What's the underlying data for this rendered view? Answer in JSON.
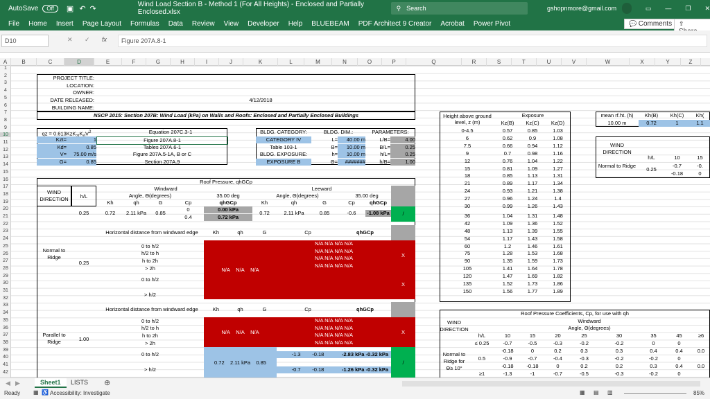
{
  "titlebar": {
    "autosave": "AutoSave",
    "toggle": "Off",
    "filename": "Wind Load Section B - Method 1 (For All Heights) - Enclosed and Partially Enclosed.xlsx",
    "search": "Search",
    "user": "gshopnmore@gmail.com"
  },
  "ribbon": {
    "tabs": [
      "File",
      "Home",
      "Insert",
      "Page Layout",
      "Formulas",
      "Data",
      "Review",
      "View",
      "Developer",
      "Help",
      "BLUEBEAM",
      "PDF Architect 9 Creator",
      "Acrobat",
      "Power Pivot"
    ],
    "comments": "Comments",
    "share": "Share"
  },
  "formula": {
    "namebox": "D10",
    "fx": "fx",
    "content": "Figure 207A.8-1"
  },
  "columns": [
    "A",
    "B",
    "C",
    "D",
    "E",
    "F",
    "G",
    "H",
    "I",
    "J",
    "K",
    "L",
    "M",
    "N",
    "O",
    "P",
    "Q",
    "R",
    "S",
    "T",
    "U",
    "V",
    "W",
    "X",
    "Y",
    "Z"
  ],
  "project": {
    "labels": [
      "PROJECT TITLE:",
      "LOCATION:",
      "OWNER:",
      "DATE RELEASED:",
      "BUILDING NAME:"
    ],
    "date": "4/12/2018",
    "heading": "NSCP 2015: Section 207B: Wind Load (kPa) on Walls and Roofs: Enclosed and Partially Enclosed Buildings"
  },
  "qz": {
    "formula": "qz = 0.613K",
    "eqn": "Equation 207C.3-1",
    "rows": [
      {
        "k": "Kzt=",
        "v": "1",
        "ref": "Figure 207A.8-1"
      },
      {
        "k": "Kd=",
        "v": "0.85",
        "ref": "Tables 207A.6-1"
      },
      {
        "k": "V=",
        "v": "75.00 m/s",
        "ref": "Figure 207A.5-1A, B or C"
      },
      {
        "k": "G=",
        "v": "0.85",
        "ref": "Section 207A.9"
      }
    ]
  },
  "bldg": {
    "cat_label": "BLDG. CATEGORY:",
    "cat": "CATEGORY IV",
    "cat_ref": "Table 103-1",
    "exp_label": "BLDG. EXPOSURE:",
    "exp": "EXPOSURE B",
    "dim_label": "BLDG. DIM.:",
    "dims": [
      {
        "k": "L=",
        "v": "40.00 m"
      },
      {
        "k": "B=",
        "v": "10.00 m"
      },
      {
        "k": "h=",
        "v": "10.00 m"
      },
      {
        "k": "Θ=",
        "v": "#######"
      }
    ],
    "param_label": "PARAMETERS:",
    "params": [
      {
        "k": "L/B=",
        "v": "4.00"
      },
      {
        "k": "B/L=",
        "v": "0.25"
      },
      {
        "k": "h/L=",
        "v": "0.25"
      },
      {
        "k": "h/B=",
        "v": "1.00"
      }
    ]
  },
  "roof": {
    "title": "Roof Pressure, q",
    "wind_dir": "WIND DIRECTION",
    "hl": "h/L",
    "windward": "Windward",
    "leeward": "Leeward",
    "angle": "Angle, Θ(degrees)",
    "deg": "35.00 deg",
    "sub": [
      "Kh",
      "qh",
      "G",
      "Cp",
      "qhGCp",
      "Kh",
      "qh",
      "G",
      "Cp",
      "qhGCp"
    ],
    "row1": {
      "hl": "0.25",
      "kh": "0.72",
      "qh": "2.11 kPa",
      "g": "0.85",
      "cp1": "0",
      "cp2": "0.4",
      "q1": "0.00 kPa",
      "q2": "0.72 kPa",
      "lkh": "0.72",
      "lqh": "2.11 kPa",
      "lg": "0.85",
      "lcp": "-0.6",
      "lq": "-1.08 kPa",
      "mark": "/"
    },
    "horiz": "Horizontal distance from windward edge",
    "normal": "Normal to Ridge",
    "parallel": "Parallel to Ridge",
    "dist1": [
      "0 to h/2",
      "h/2 to h",
      "h to 2h",
      "> 2h",
      "0 to h/2",
      "> h/2"
    ],
    "na": "N/A",
    "x": "X",
    "hl2": "0.25",
    "hl3": "1.00",
    "last": [
      {
        "d": "0 to h/2",
        "cp": "-1.3",
        "cp2": "-0.18",
        "q1": "-2.83 kPa",
        "q2": "-0.32 kPa"
      },
      {
        "d": "> h/2",
        "cp": "-0.7",
        "cp2": "-0.18",
        "q1": "-1.26 kPa",
        "q2": "-0.32 kPa"
      }
    ],
    "last_kh": "0.72",
    "last_qh": "2.11 kPa",
    "last_g": "0.85"
  },
  "exposure": {
    "h_label": "Height above ground level, z (m)",
    "title": "Exposure",
    "cols": [
      "Kz(B)",
      "Kz(C)",
      "Kz(D)"
    ],
    "rows": [
      [
        "0-4.5",
        "0.57",
        "0.85",
        "1.03"
      ],
      [
        "6",
        "0.62",
        "0.9",
        "1.08"
      ],
      [
        "7.5",
        "0.66",
        "0.94",
        "1.12"
      ],
      [
        "9",
        "0.7",
        "0.98",
        "1.16"
      ],
      [
        "12",
        "0.76",
        "1.04",
        "1.22"
      ],
      [
        "15",
        "0.81",
        "1.09",
        "1.27"
      ],
      [
        "18",
        "0.85",
        "1.13",
        "1.31"
      ],
      [
        "21",
        "0.89",
        "1.17",
        "1.34"
      ],
      [
        "24",
        "0.93",
        "1.21",
        "1.38"
      ],
      [
        "27",
        "0.96",
        "1.24",
        "1.4"
      ],
      [
        "30",
        "0.99",
        "1.26",
        "1.43"
      ],
      [
        "36",
        "1.04",
        "1.31",
        "1.48"
      ],
      [
        "42",
        "1.09",
        "1.36",
        "1.52"
      ],
      [
        "48",
        "1.13",
        "1.39",
        "1.55"
      ],
      [
        "54",
        "1.17",
        "1.43",
        "1.58"
      ],
      [
        "60",
        "1.2",
        "1.46",
        "1.61"
      ],
      [
        "75",
        "1.28",
        "1.53",
        "1.68"
      ],
      [
        "90",
        "1.35",
        "1.59",
        "1.73"
      ],
      [
        "105",
        "1.41",
        "1.64",
        "1.78"
      ],
      [
        "120",
        "1.47",
        "1.69",
        "1.82"
      ],
      [
        "135",
        "1.52",
        "1.73",
        "1.86"
      ],
      [
        "150",
        "1.56",
        "1.77",
        "1.89"
      ]
    ]
  },
  "meanrf": {
    "label": "mean rf.ht. (h)",
    "val": "10.00 m",
    "kb": "Kh(B)",
    "kc": "Kh(C)",
    "kd": "Kh(",
    "vb": "0.72",
    "vc": "1",
    "vd": "1.1"
  },
  "wind2": {
    "dir": "WIND DIRECTION",
    "hl": "h/L",
    "c10": "10",
    "c15": "15",
    "nr": "Normal to Ridge",
    "v": "0.25",
    "a": "-0.7",
    "b": "-0.18",
    "c": "-0.",
    "d": "0"
  },
  "roofcoef": {
    "title": "Roof Pressure Coefficients, Cp, for use with qh",
    "windward": "Windward",
    "angle": "Angle, Θ(degrees)",
    "hdr": [
      "h/L",
      "10",
      "15",
      "20",
      "25",
      "30",
      "35",
      "45",
      "≥6"
    ],
    "wd": "WIND DIRECTION",
    "nr": "Normal to Ridge for Θ≥ 10°",
    "rows": [
      [
        "≤ 0.25",
        "-0.7",
        "-0.5",
        "-0.3",
        "-0.2",
        "-0.2",
        "0",
        "0",
        ""
      ],
      [
        "",
        "-0.18",
        "0",
        "0.2",
        "0.3",
        "0.3",
        "0.4",
        "0.4",
        "0.0"
      ],
      [
        "0.5",
        "-0.9",
        "-0.7",
        "-0.4",
        "-0.3",
        "-0.2",
        "-0.2",
        "0",
        ""
      ],
      [
        "",
        "-0.18",
        "-0.18",
        "0",
        "0.2",
        "0.2",
        "0.3",
        "0.4",
        "0.0"
      ],
      [
        "≥1",
        "-1.3",
        "-1",
        "-0.7",
        "-0.5",
        "-0.3",
        "-0.2",
        "0",
        ""
      ]
    ]
  },
  "sheets": [
    "Sheet1",
    "LISTS"
  ],
  "status": {
    "ready": "Ready",
    "access": "Accessibility: Investigate",
    "zoom": "85%"
  }
}
